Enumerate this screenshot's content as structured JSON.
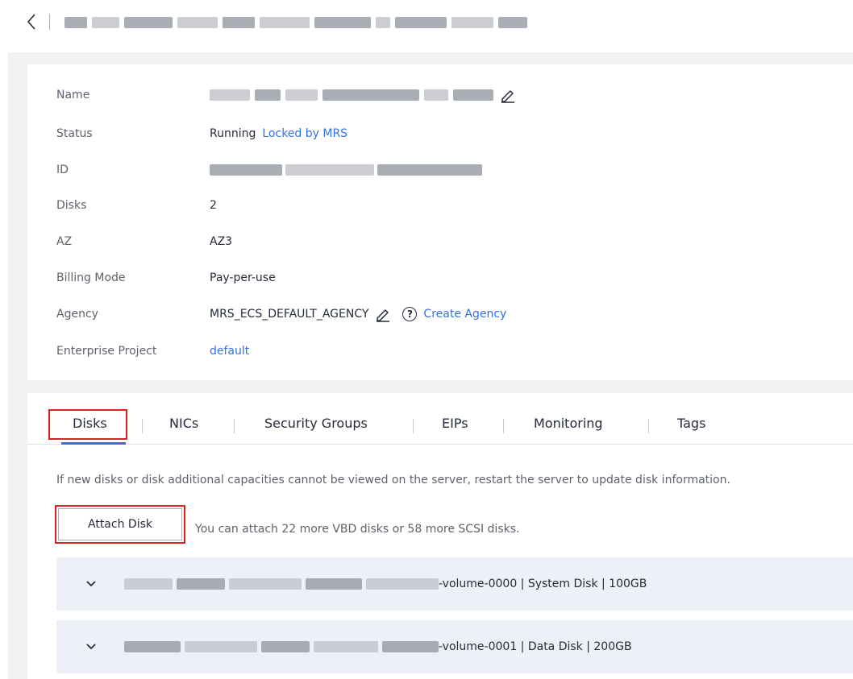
{
  "summary": {
    "rows": [
      {
        "label": "Name",
        "value": ""
      },
      {
        "label": "Status",
        "value": "Running",
        "link": "Locked by MRS"
      },
      {
        "label": "ID",
        "value": ""
      },
      {
        "label": "Disks",
        "value": "2"
      },
      {
        "label": "AZ",
        "value": "AZ3"
      },
      {
        "label": "Billing Mode",
        "value": "Pay-per-use"
      },
      {
        "label": "Agency",
        "value": "MRS_ECS_DEFAULT_AGENCY",
        "link": "Create Agency"
      },
      {
        "label": "Enterprise Project",
        "value": "",
        "link": "default"
      }
    ]
  },
  "tabs": [
    {
      "label": "Disks",
      "active": true
    },
    {
      "label": "NICs"
    },
    {
      "label": "Security Groups"
    },
    {
      "label": "EIPs"
    },
    {
      "label": "Monitoring"
    },
    {
      "label": "Tags"
    }
  ],
  "disks_tab": {
    "notice": "If new disks or disk additional capacities cannot be viewed on the server, restart the server to update disk information.",
    "attach_button": "Attach Disk",
    "attach_hint": "You can attach 22 more VBD disks or 58 more SCSI disks.",
    "disks": [
      {
        "suffix": "-volume-0000 | System Disk | 100GB"
      },
      {
        "suffix": "-volume-0001 | Data Disk | 200GB"
      }
    ]
  },
  "colors": {
    "link": "#3370e6",
    "highlight_box": "#e02020",
    "tab_underline": "#3370e6",
    "disk_row_bg": "#edf0f7"
  },
  "icons": [
    "back-chevron-icon",
    "edit-pencil-icon",
    "help-circle-icon",
    "expand-chevron-icon"
  ]
}
